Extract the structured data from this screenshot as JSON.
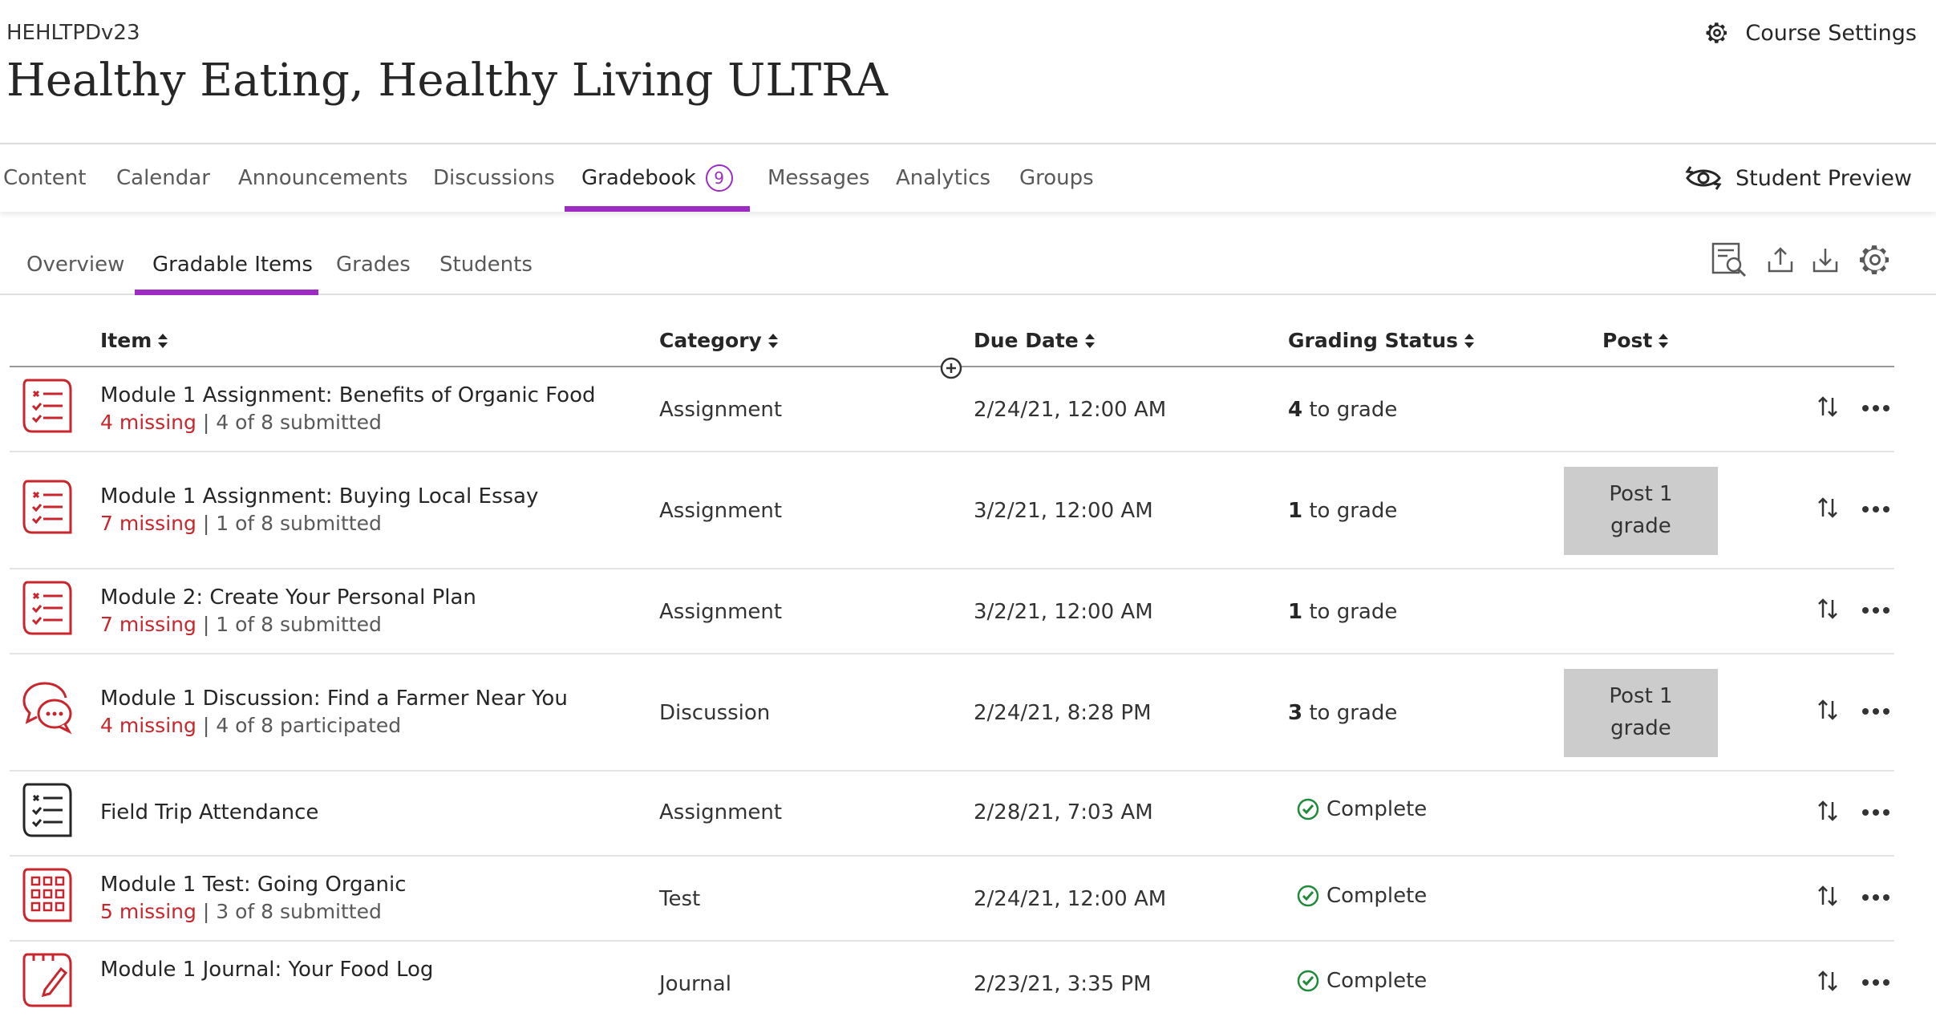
{
  "header": {
    "course_code": "HEHLTPDv23",
    "course_title": "Healthy Eating, Healthy Living ULTRA",
    "course_settings_label": "Course Settings"
  },
  "nav": {
    "tabs": [
      {
        "label": "Content"
      },
      {
        "label": "Calendar"
      },
      {
        "label": "Announcements"
      },
      {
        "label": "Discussions"
      },
      {
        "label": "Gradebook",
        "badge": "9",
        "active": true
      },
      {
        "label": "Messages"
      },
      {
        "label": "Analytics"
      },
      {
        "label": "Groups"
      }
    ],
    "student_preview_label": "Student Preview"
  },
  "subnav": {
    "tabs": [
      {
        "label": "Overview"
      },
      {
        "label": "Gradable Items",
        "active": true
      },
      {
        "label": "Grades"
      },
      {
        "label": "Students"
      }
    ],
    "tools": [
      "search-submissions-icon",
      "upload-icon",
      "download-icon",
      "gear-icon"
    ]
  },
  "table": {
    "headers": {
      "item": "Item",
      "category": "Category",
      "due_date": "Due Date",
      "grading_status": "Grading Status",
      "post": "Post"
    },
    "rows": [
      {
        "icon": "assignment-icon",
        "icon_color": "#c9252c",
        "title": "Module 1 Assignment: Benefits of Organic Food",
        "missing": "4 missing",
        "separator": "|",
        "submitted": "4 of 8 submitted",
        "category": "Assignment",
        "due": "2/24/21, 12:00 AM",
        "grade_count": "4",
        "grade_text": "to grade",
        "post_label": ""
      },
      {
        "icon": "assignment-icon",
        "icon_color": "#c9252c",
        "title": "Module 1 Assignment: Buying Local Essay",
        "missing": "7 missing",
        "separator": "|",
        "submitted": "1 of 8 submitted",
        "category": "Assignment",
        "due": "3/2/21, 12:00 AM",
        "grade_count": "1",
        "grade_text": "to grade",
        "post_label_1": "Post 1",
        "post_label_2": "grade"
      },
      {
        "icon": "assignment-icon",
        "icon_color": "#c9252c",
        "title": "Module 2: Create Your Personal Plan",
        "missing": "7 missing",
        "separator": "|",
        "submitted": "1 of 8 submitted",
        "category": "Assignment",
        "due": "3/2/21, 12:00 AM",
        "grade_count": "1",
        "grade_text": "to grade",
        "post_label": ""
      },
      {
        "icon": "discussion-icon",
        "icon_color": "#c9252c",
        "title": "Module 1 Discussion: Find a Farmer Near You",
        "missing": "4 missing",
        "separator": "|",
        "submitted": "4 of 8 participated",
        "category": "Discussion",
        "due": "2/24/21, 8:28 PM",
        "grade_count": "3",
        "grade_text": "to grade",
        "post_label_1": "Post 1",
        "post_label_2": "grade"
      },
      {
        "icon": "assignment-icon",
        "icon_color": "#262626",
        "title": "Field Trip Attendance",
        "category": "Assignment",
        "due": "2/28/21, 7:03 AM",
        "status": "Complete"
      },
      {
        "icon": "test-icon",
        "icon_color": "#c9252c",
        "title": "Module 1 Test: Going Organic",
        "missing": "5 missing",
        "separator": "|",
        "submitted": "3 of 8 submitted",
        "category": "Test",
        "due": "2/24/21, 12:00 AM",
        "status": "Complete"
      },
      {
        "icon": "journal-icon",
        "icon_color": "#c9252c",
        "title": "Module 1 Journal: Your Food Log",
        "category": "Journal",
        "due": "2/23/21, 3:35 PM",
        "status": "Complete"
      }
    ]
  },
  "colors": {
    "accent": "#9e2bc2",
    "missing": "#c9252c",
    "complete": "#1f8a3a",
    "post_button_bg": "#cccccc"
  }
}
